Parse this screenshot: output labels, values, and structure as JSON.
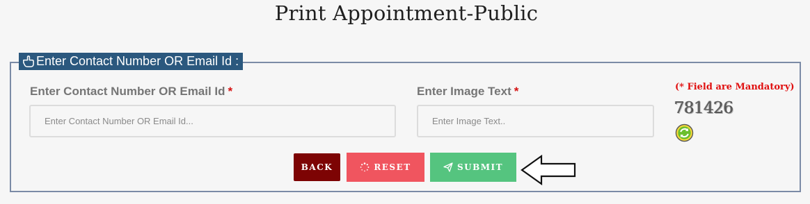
{
  "page": {
    "title": "Print Appointment-Public"
  },
  "legend": {
    "label": "Enter Contact Number OR Email Id :",
    "icon": "hand-pointing-icon"
  },
  "form": {
    "contact": {
      "label": "Enter Contact Number OR Email Id",
      "required_mark": "*",
      "placeholder": "Enter Contact Number OR Email Id...",
      "value": ""
    },
    "image_text": {
      "label": "Enter Image Text",
      "required_mark": "*",
      "placeholder": "Enter Image Text..",
      "value": ""
    },
    "mandatory_note": "(* Field are Mandatory)",
    "captcha": {
      "text": "781426",
      "refresh_icon": "refresh-icon"
    }
  },
  "buttons": {
    "back": "BACK",
    "reset": "RESET",
    "submit": "SUBMIT"
  },
  "colors": {
    "legend_bg": "#2b587e",
    "back_bg": "#7d0404",
    "reset_bg": "#f0555f",
    "submit_bg": "#55c47f",
    "required": "#d51212"
  }
}
